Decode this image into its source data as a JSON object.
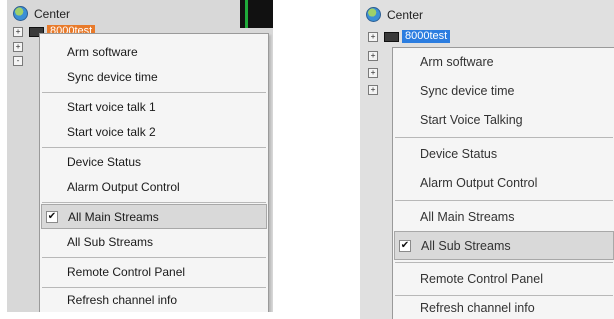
{
  "left_panel": {
    "root_label": "Center",
    "device_label": "8000test",
    "tree_expanders": [
      "+",
      "+",
      "-"
    ],
    "menu": {
      "items": [
        {
          "label": "Arm software"
        },
        {
          "label": "Sync device time"
        },
        {
          "label": "Start voice talk 1"
        },
        {
          "label": "Start voice talk 2"
        },
        {
          "label": "Device Status"
        },
        {
          "label": "Alarm Output Control"
        },
        {
          "label": "All Main Streams",
          "checked": true,
          "highlighted": true
        },
        {
          "label": "All Sub Streams"
        },
        {
          "label": "Remote Control Panel"
        },
        {
          "label": "Refresh channel info"
        }
      ]
    }
  },
  "right_panel": {
    "root_label": "Center",
    "device_label": "8000test",
    "tree_expanders": [
      "+",
      "+",
      "+",
      "+"
    ],
    "menu": {
      "items": [
        {
          "label": "Arm software"
        },
        {
          "label": "Sync device time"
        },
        {
          "label": "Start Voice Talking"
        },
        {
          "label": "Device Status"
        },
        {
          "label": "Alarm Output Control"
        },
        {
          "label": "All Main Streams"
        },
        {
          "label": "All Sub Streams",
          "checked": true,
          "highlighted": true
        },
        {
          "label": "Remote Control Panel"
        },
        {
          "label": "Refresh channel info"
        }
      ]
    }
  },
  "colors": {
    "device_label_left": "#e87a2a",
    "device_label_right": "#2b7de0",
    "checkbox_mark": "#111111"
  },
  "icons": {
    "root": "globe-icon",
    "device": "dvr-device-icon",
    "checkmark": "checkmark-icon"
  }
}
